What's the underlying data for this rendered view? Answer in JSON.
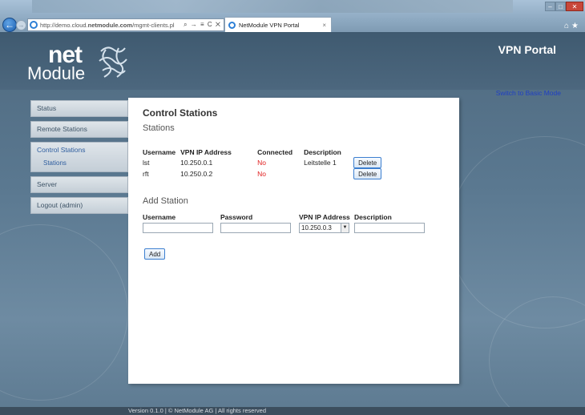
{
  "browser": {
    "url_prefix": "http://demo.cloud.",
    "url_domain": "netmodule.com",
    "url_path": "/mgmt-clients.pl",
    "address_tools": "⌕ → ≡ C ✕",
    "tab_title": "NetModule VPN Portal",
    "tab_close": "×"
  },
  "header": {
    "logo_net": "net",
    "logo_module": "Module",
    "title": "VPN Portal",
    "switch_mode": "Switch to Basic Mode"
  },
  "sidebar": {
    "status": "Status",
    "remote_stations": "Remote Stations",
    "control_stations": "Control Stations",
    "stations": "Stations",
    "server": "Server",
    "logout": "Logout (admin)"
  },
  "content": {
    "title": "Control Stations",
    "subtitle": "Stations",
    "columns": [
      "Username",
      "VPN IP Address",
      "Connected",
      "Description"
    ],
    "rows": [
      {
        "username": "lst",
        "ip": "10.250.0.1",
        "connected": "No",
        "description": "Leitstelle 1",
        "action": "Delete"
      },
      {
        "username": "rft",
        "ip": "10.250.0.2",
        "connected": "No",
        "description": "",
        "action": "Delete"
      }
    ],
    "add_title": "Add Station",
    "add_labels": {
      "username": "Username",
      "password": "Password",
      "vpn_ip": "VPN IP Address",
      "description": "Description"
    },
    "add_values": {
      "username": "",
      "password": "",
      "vpn_ip": "10.250.0.3",
      "description": ""
    },
    "add_button": "Add"
  },
  "footer": {
    "text": "Version 0.1.0 | © NetModule AG | All rights reserved"
  },
  "colors": {
    "accent": "#1f3fc4",
    "status_no": "#e02020",
    "background": "#4f6a80"
  },
  "icons": [
    "back-arrow-icon",
    "forward-arrow-icon",
    "ie-icon",
    "close-icon",
    "home-icon",
    "star-icon",
    "netmodule-logo-mark",
    "dropdown-arrow-icon"
  ]
}
